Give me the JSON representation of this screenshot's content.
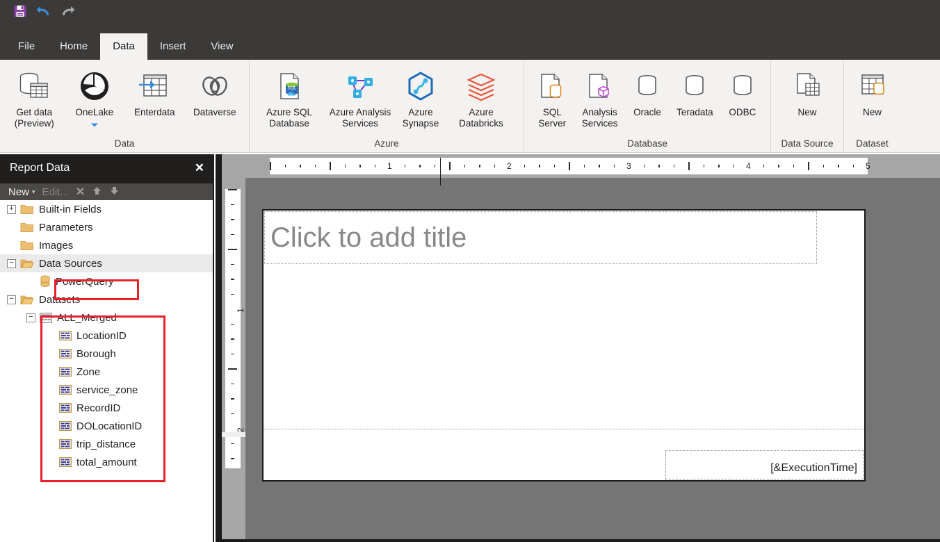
{
  "quick_access": {
    "items": [
      {
        "name": "save-icon",
        "label": "Save"
      },
      {
        "name": "undo-icon",
        "label": "Undo"
      },
      {
        "name": "redo-icon",
        "label": "Redo"
      }
    ]
  },
  "ribbon": {
    "tabs": [
      {
        "label": "File",
        "active": false
      },
      {
        "label": "Home",
        "active": false
      },
      {
        "label": "Data",
        "active": true
      },
      {
        "label": "Insert",
        "active": false
      },
      {
        "label": "View",
        "active": false
      }
    ],
    "groups": [
      {
        "label": "Data",
        "items": [
          {
            "label": "Get data\n(Preview)",
            "icon": "get-data-icon",
            "has_caret": false
          },
          {
            "label": "OneLake",
            "icon": "onelake-icon",
            "has_caret": true
          },
          {
            "label": "Enterdata",
            "icon": "enter-data-icon",
            "has_caret": false
          },
          {
            "label": "Dataverse",
            "icon": "dataverse-icon",
            "has_caret": false
          }
        ]
      },
      {
        "label": "Azure",
        "items": [
          {
            "label": "Azure SQL\nDatabase",
            "icon": "azure-sql-database-icon",
            "has_caret": false
          },
          {
            "label": "Azure Analysis\nServices",
            "icon": "azure-analysis-services-icon",
            "has_caret": false
          },
          {
            "label": "Azure\nSynapse",
            "icon": "azure-synapse-icon",
            "has_caret": false
          },
          {
            "label": "Azure\nDatabricks",
            "icon": "azure-databricks-icon",
            "has_caret": false
          }
        ]
      },
      {
        "label": "Database",
        "items": [
          {
            "label": "SQL\nServer",
            "icon": "sql-server-icon",
            "has_caret": false
          },
          {
            "label": "Analysis\nServices",
            "icon": "analysis-services-icon",
            "has_caret": false
          },
          {
            "label": "Oracle",
            "icon": "oracle-icon",
            "has_caret": false
          },
          {
            "label": "Teradata",
            "icon": "teradata-icon",
            "has_caret": false
          },
          {
            "label": "ODBC",
            "icon": "odbc-icon",
            "has_caret": false
          }
        ]
      },
      {
        "label": "Data Source",
        "items": [
          {
            "label": "New",
            "icon": "new-data-source-icon",
            "has_caret": false
          }
        ]
      },
      {
        "label": "Dataset",
        "items": [
          {
            "label": "New",
            "icon": "new-dataset-icon",
            "has_caret": false
          }
        ]
      }
    ]
  },
  "report_data_pane": {
    "title": "Report Data",
    "close_label": "✕",
    "toolbar": {
      "new_label": "New",
      "new_caret": "▾",
      "edit_label": "Edit...",
      "delete_label": "✕",
      "move_up_label": "↑",
      "move_down_label": "↓"
    },
    "tree": [
      {
        "label": "Built-in Fields",
        "icon": "folder-icon",
        "expander": "+",
        "indent": 0
      },
      {
        "label": "Parameters",
        "icon": "folder-icon",
        "expander": "",
        "indent": 0
      },
      {
        "label": "Images",
        "icon": "folder-icon",
        "expander": "",
        "indent": 0
      },
      {
        "label": "Data Sources",
        "icon": "folder-open-icon",
        "expander": "−",
        "indent": 0,
        "selected": true
      },
      {
        "label": "PowerQuery",
        "icon": "data-source-icon",
        "expander": "",
        "indent": 1,
        "highlighted": true
      },
      {
        "label": "Datasets",
        "icon": "folder-open-icon",
        "expander": "−",
        "indent": 0
      },
      {
        "label": "ALL_Merged",
        "icon": "dataset-table-icon",
        "expander": "−",
        "indent": 1
      },
      {
        "label": "LocationID",
        "icon": "field-icon",
        "expander": "",
        "indent": 2
      },
      {
        "label": "Borough",
        "icon": "field-icon",
        "expander": "",
        "indent": 2
      },
      {
        "label": "Zone",
        "icon": "field-icon",
        "expander": "",
        "indent": 2
      },
      {
        "label": "service_zone",
        "icon": "field-icon",
        "expander": "",
        "indent": 2
      },
      {
        "label": "RecordID",
        "icon": "field-icon",
        "expander": "",
        "indent": 2
      },
      {
        "label": "DOLocationID",
        "icon": "field-icon",
        "expander": "",
        "indent": 2
      },
      {
        "label": "trip_distance",
        "icon": "field-icon",
        "expander": "",
        "indent": 2
      },
      {
        "label": "total_amount",
        "icon": "field-icon",
        "expander": "",
        "indent": 2
      }
    ],
    "annotation_color": "#e8202a"
  },
  "design_surface": {
    "title_placeholder": "Click to add title",
    "footer_expression": "[&ExecutionTime]",
    "horizontal_ruler_numbers": [
      "1",
      "2",
      "3",
      "4",
      "5"
    ],
    "vertical_ruler_numbers": [
      "1",
      "2"
    ]
  },
  "colors": {
    "ribbon_bg": "#f3f2f1",
    "titlebar_bg": "#3b3a39",
    "pane_header_bg": "#201f1e",
    "pane_toolbar_bg": "#4a4947",
    "canvas_bg": "#757575",
    "ruler_gutter_bg": "#a6a6a6",
    "accent_red": "#e8202a",
    "save_purple": "#8a3ea8",
    "undo_blue": "#3b8dd8"
  }
}
